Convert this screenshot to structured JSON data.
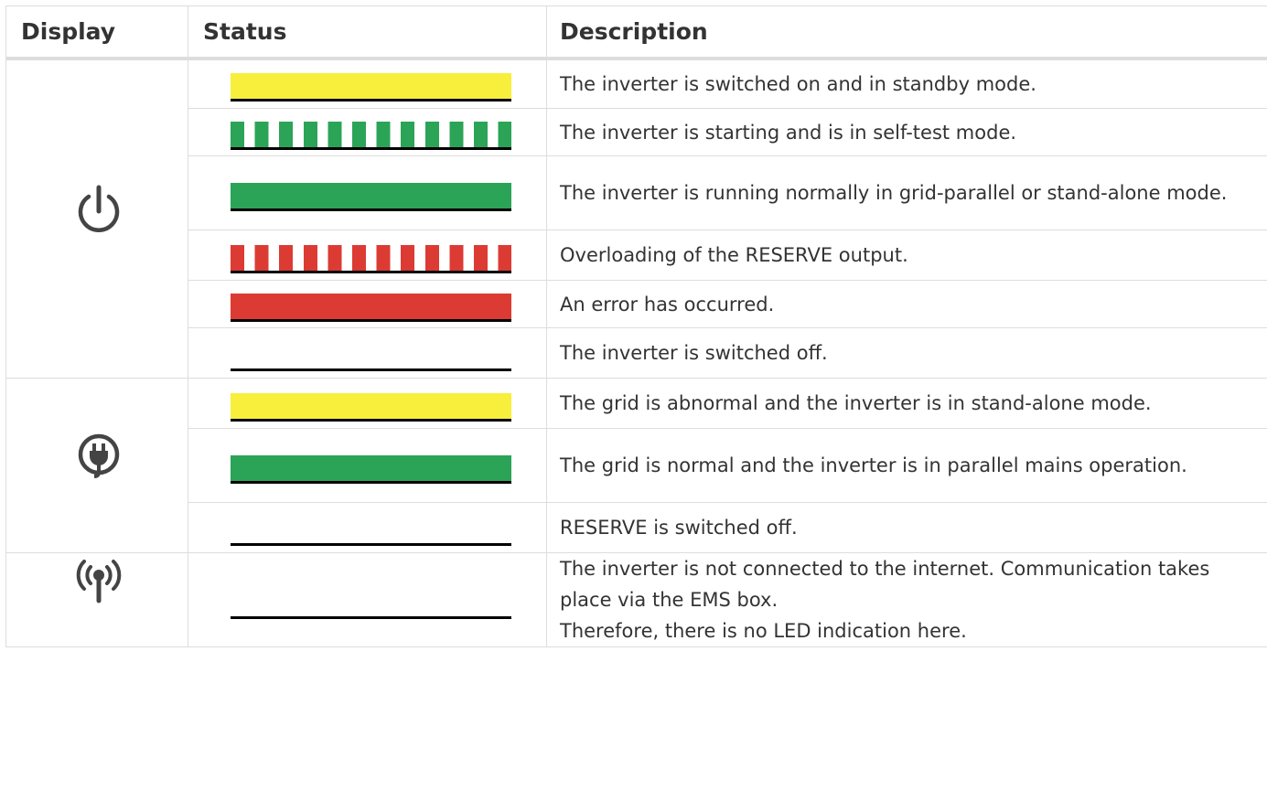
{
  "headers": {
    "display": "Display",
    "status": "Status",
    "description": "Description"
  },
  "colors": {
    "yellow": "#f7ef3c",
    "green": "#2ca457",
    "red": "#dc3b33",
    "off": "none"
  },
  "groups": [
    {
      "icon": "power-icon",
      "rows": [
        {
          "led": "solid",
          "color": "yellow",
          "description": [
            "The inverter is switched on and in standby mode."
          ]
        },
        {
          "led": "blinking",
          "color": "green",
          "description": [
            "The inverter is starting and is in self-test mode."
          ]
        },
        {
          "led": "solid",
          "color": "green",
          "description": [
            "The inverter is running normally in grid-parallel or stand-alone mode."
          ]
        },
        {
          "led": "blinking",
          "color": "red",
          "description": [
            "Overloading of the RESERVE output."
          ]
        },
        {
          "led": "solid",
          "color": "red",
          "description": [
            "An error has occurred."
          ]
        },
        {
          "led": "off",
          "color": "off",
          "description": [
            "The inverter is switched off."
          ]
        }
      ]
    },
    {
      "icon": "plug-icon",
      "rows": [
        {
          "led": "solid",
          "color": "yellow",
          "description": [
            "The grid is abnormal and the inverter is in stand-alone mode."
          ]
        },
        {
          "led": "solid",
          "color": "green",
          "description": [
            "The grid is normal and the inverter is in parallel mains operation."
          ]
        },
        {
          "led": "off",
          "color": "off",
          "description": [
            "RESERVE is switched off."
          ]
        }
      ]
    },
    {
      "icon": "antenna-icon",
      "rows": [
        {
          "led": "off",
          "color": "off",
          "description": [
            "The inverter is not connected to the internet. Communication takes place via the EMS box.",
            "Therefore, there is no LED indication here."
          ]
        }
      ]
    }
  ]
}
